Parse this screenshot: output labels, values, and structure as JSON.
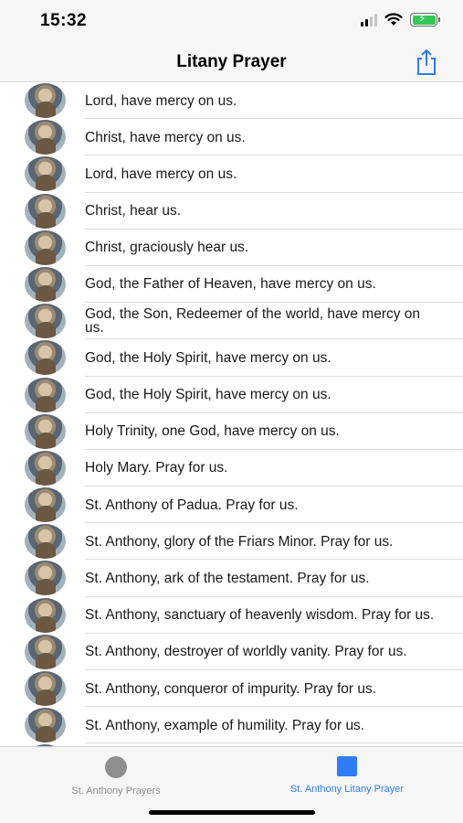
{
  "status_bar": {
    "time": "15:32"
  },
  "nav": {
    "title": "Litany Prayer",
    "share_icon": "share-icon"
  },
  "colors": {
    "accent": "#2f7cf6",
    "inactive": "#8f8f8f",
    "battery": "#34c759"
  },
  "items": [
    {
      "text": "Lord, have mercy on us."
    },
    {
      "text": "Christ, have mercy on us."
    },
    {
      "text": "Lord, have mercy on us."
    },
    {
      "text": "Christ, hear us."
    },
    {
      "text": "Christ, graciously hear us."
    },
    {
      "text": "God, the Father of Heaven, have mercy on us."
    },
    {
      "text": "God, the Son, Redeemer of the world, have mercy on us."
    },
    {
      "text": "God, the Holy Spirit, have mercy on us."
    },
    {
      "text": "God, the Holy Spirit, have mercy on us."
    },
    {
      "text": "Holy Trinity, one God, have mercy on us."
    },
    {
      "text": "Holy Mary. Pray for us."
    },
    {
      "text": "St. Anthony of Padua. Pray for us."
    },
    {
      "text": "St. Anthony, glory of the Friars Minor. Pray for us."
    },
    {
      "text": "St. Anthony, ark of the testament. Pray for us."
    },
    {
      "text": "St. Anthony, sanctuary of heavenly wisdom. Pray for us."
    },
    {
      "text": "St. Anthony, destroyer of worldly vanity. Pray for us."
    },
    {
      "text": "St. Anthony, conqueror of impurity. Pray for us."
    },
    {
      "text": "St. Anthony, example of humility. Pray for us."
    }
  ],
  "tabs": [
    {
      "label": "St. Anthony Prayers",
      "icon": "circle-icon",
      "selected": false
    },
    {
      "label": "St. Anthony Litany Prayer",
      "icon": "square-icon",
      "selected": true
    }
  ]
}
